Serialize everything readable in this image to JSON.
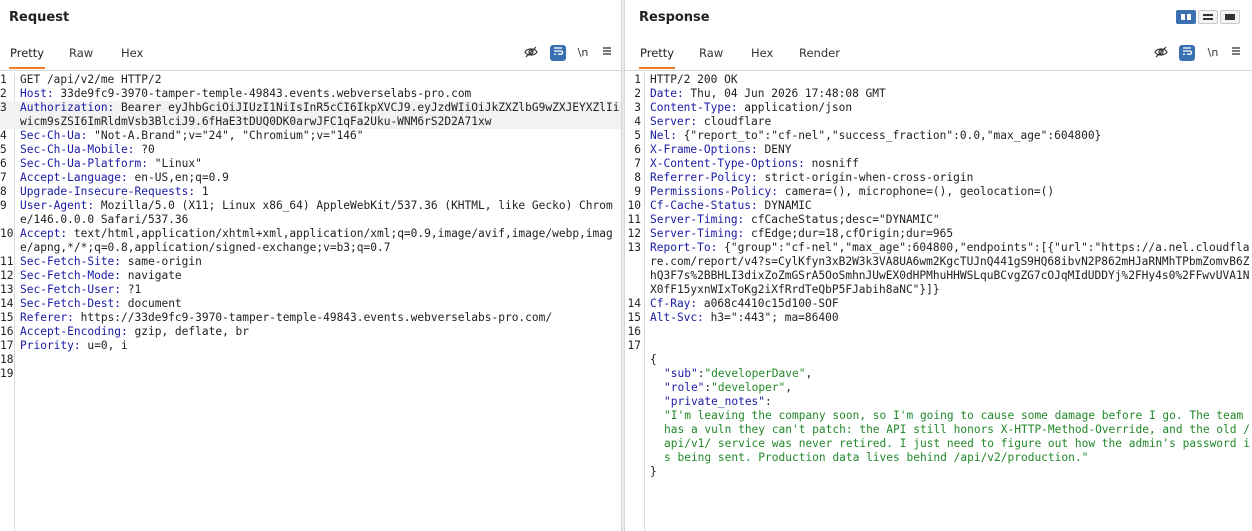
{
  "request": {
    "title": "Request",
    "tabs": [
      "Pretty",
      "Raw",
      "Hex"
    ],
    "tools": {
      "hide_icon": "eye-off-icon",
      "format_icon": "wrap-icon",
      "newline_label": "\\n",
      "menu_icon": "menu-icon"
    },
    "lines": [
      {
        "n": "1",
        "k": "GET /api/v2/me HTTP/2",
        "v": ""
      },
      {
        "n": "2",
        "k": "Host:",
        "v": " 33de9fc9-3970-tamper-temple-49843.events.webverselabs-pro.com"
      },
      {
        "n": "3",
        "k": "Authorization:",
        "v": " Bearer eyJhbGciOiJIUzI1NiIsInR5cCI6IkpXVCJ9.eyJzdWIiOiJkZXZlbG9wZXJEYXZlIiwicm9sZSI6ImRldmVsb3BlciJ9.6fHaE3tDUQ0DK0arwJFC1qFa2Uku-WNM6rS2D2A71xw"
      },
      {
        "n": "4",
        "k": "Sec-Ch-Ua:",
        "v": " \"Not-A.Brand\";v=\"24\", \"Chromium\";v=\"146\""
      },
      {
        "n": "5",
        "k": "Sec-Ch-Ua-Mobile:",
        "v": " ?0"
      },
      {
        "n": "6",
        "k": "Sec-Ch-Ua-Platform:",
        "v": " \"Linux\""
      },
      {
        "n": "7",
        "k": "Accept-Language:",
        "v": " en-US,en;q=0.9"
      },
      {
        "n": "8",
        "k": "Upgrade-Insecure-Requests:",
        "v": " 1"
      },
      {
        "n": "9",
        "k": "User-Agent:",
        "v": " Mozilla/5.0 (X11; Linux x86_64) AppleWebKit/537.36 (KHTML, like Gecko) Chrome/146.0.0.0 Safari/537.36"
      },
      {
        "n": "10",
        "k": "Accept:",
        "v": " text/html,application/xhtml+xml,application/xml;q=0.9,image/avif,image/webp,image/apng,*/*;q=0.8,application/signed-exchange;v=b3;q=0.7"
      },
      {
        "n": "11",
        "k": "Sec-Fetch-Site:",
        "v": " same-origin"
      },
      {
        "n": "12",
        "k": "Sec-Fetch-Mode:",
        "v": " navigate"
      },
      {
        "n": "13",
        "k": "Sec-Fetch-User:",
        "v": " ?1"
      },
      {
        "n": "14",
        "k": "Sec-Fetch-Dest:",
        "v": " document"
      },
      {
        "n": "15",
        "k": "Referer:",
        "v": " https://33de9fc9-3970-tamper-temple-49843.events.webverselabs-pro.com/"
      },
      {
        "n": "16",
        "k": "Accept-Encoding:",
        "v": " gzip, deflate, br"
      },
      {
        "n": "17",
        "k": "Priority:",
        "v": " u=0, i"
      },
      {
        "n": "18",
        "k": "",
        "v": ""
      },
      {
        "n": "19",
        "k": "",
        "v": ""
      }
    ]
  },
  "response": {
    "title": "Response",
    "tabs": [
      "Pretty",
      "Raw",
      "Hex",
      "Render"
    ],
    "tools": {
      "hide_icon": "eye-off-icon",
      "format_icon": "wrap-icon",
      "newline_label": "\\n",
      "menu_icon": "menu-icon"
    },
    "lines": [
      {
        "n": "1",
        "k": "HTTP/2 200 OK",
        "v": ""
      },
      {
        "n": "2",
        "k": "Date:",
        "v": " Thu, 04 Jun 2026 17:48:08 GMT"
      },
      {
        "n": "3",
        "k": "Content-Type:",
        "v": " application/json"
      },
      {
        "n": "4",
        "k": "Server:",
        "v": " cloudflare"
      },
      {
        "n": "5",
        "k": "Nel:",
        "v": " {\"report_to\":\"cf-nel\",\"success_fraction\":0.0,\"max_age\":604800}"
      },
      {
        "n": "6",
        "k": "X-Frame-Options:",
        "v": " DENY"
      },
      {
        "n": "7",
        "k": "X-Content-Type-Options:",
        "v": " nosniff"
      },
      {
        "n": "8",
        "k": "Referrer-Policy:",
        "v": " strict-origin-when-cross-origin"
      },
      {
        "n": "9",
        "k": "Permissions-Policy:",
        "v": " camera=(), microphone=(), geolocation=()"
      },
      {
        "n": "10",
        "k": "Cf-Cache-Status:",
        "v": " DYNAMIC"
      },
      {
        "n": "11",
        "k": "Server-Timing:",
        "v": " cfCacheStatus;desc=\"DYNAMIC\""
      },
      {
        "n": "12",
        "k": "Server-Timing:",
        "v": " cfEdge;dur=18,cfOrigin;dur=965"
      },
      {
        "n": "13",
        "k": "Report-To:",
        "v": " {\"group\":\"cf-nel\",\"max_age\":604800,\"endpoints\":[{\"url\":\"https://a.nel.cloudflare.com/report/v4?s=CylKfyn3xB2W3k3VA8UA6wm2KgcTUJnQ441gS9HQ68ibvN2P862mHJaRNMhTPbmZomvB6ZhQ3F7s%2BBHLI3dixZoZmGSrA5OoSmhnJUwEX0dHPMhuHHWSLquBCvgZG7cOJqMIdUDDYj%2FHy4s0%2FFwvUVA1NX0fF15yxnWIxToKg2iXfRrdTeQbP5FJabih8aNC\"}]}"
      },
      {
        "n": "14",
        "k": "Cf-Ray:",
        "v": " a068c4410c15d100-SOF"
      },
      {
        "n": "15",
        "k": "Alt-Svc:",
        "v": " h3=\":443\"; ma=86400"
      },
      {
        "n": "16",
        "k": "",
        "v": ""
      },
      {
        "n": "17",
        "k": "",
        "v": ""
      }
    ],
    "json_body": {
      "open": "{",
      "fields": [
        {
          "key": "\"sub\"",
          "sep": ":",
          "val": "\"developerDave\"",
          "comma": ","
        },
        {
          "key": "\"role\"",
          "sep": ":",
          "val": "\"developer\"",
          "comma": ","
        },
        {
          "key": "\"private_notes\"",
          "sep": ":",
          "val": "",
          "comma": ""
        }
      ],
      "note": "\"I'm leaving the company soon, so I'm going to cause some damage before I go. The team has a vuln they can't patch: the API still honors X-HTTP-Method-Override, and the old /api/v1/ service was never retired. I just need to figure out how the admin's password is being sent. Production data lives behind /api/v2/production.\"",
      "close": "}"
    }
  },
  "layout_icons": [
    "split-vertical-icon",
    "split-horizontal-icon",
    "single-pane-icon"
  ]
}
